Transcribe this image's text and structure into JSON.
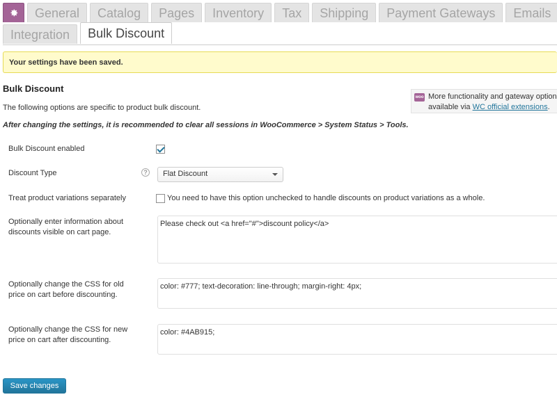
{
  "tabs": {
    "row1": [
      "General",
      "Catalog",
      "Pages",
      "Inventory",
      "Tax",
      "Shipping",
      "Payment Gateways",
      "Emails"
    ],
    "row2": [
      "Integration",
      "Bulk Discount"
    ],
    "active": "Bulk Discount"
  },
  "notice": "Your settings have been saved.",
  "section": {
    "title": "Bulk Discount",
    "description": "The following options are specific to product bulk discount.",
    "warning": "After changing the settings, it is recommended to clear all sessions in WooCommerce > System Status > Tools."
  },
  "promo": {
    "line1": "More functionality and gateway options",
    "line2_prefix": "available via ",
    "link": "WC official extensions",
    "line2_suffix": ".",
    "badge": "woo"
  },
  "fields": {
    "enabled_label": "Bulk Discount enabled",
    "enabled_checked": true,
    "type_label": "Discount Type",
    "type_value": "Flat Discount",
    "variations_label": "Treat product variations separately",
    "variations_checked": false,
    "variations_help": "You need to have this option unchecked to handle discounts on product variations as a whole.",
    "info_label_1": "Optionally enter information about",
    "info_label_2": "discounts visible on cart page.",
    "info_value": "Please check out <a href=\"#\">discount policy</a>",
    "old_css_label_1": "Optionally change the CSS for old",
    "old_css_label_2": "price on cart before discounting.",
    "old_css_value": "color: #777; text-decoration: line-through; margin-right: 4px;",
    "new_css_label_1": "Optionally change the CSS for new",
    "new_css_label_2": "price on cart after discounting.",
    "new_css_value": "color: #4AB915;"
  },
  "save_label": "Save changes",
  "icons": {
    "settings_tab": "gear-icon",
    "help": "help-icon",
    "dropdown": "chevron-down-icon"
  },
  "colors": {
    "accent": "#21759b",
    "woo_purple": "#a46497",
    "notice_bg": "#fffbcc"
  }
}
